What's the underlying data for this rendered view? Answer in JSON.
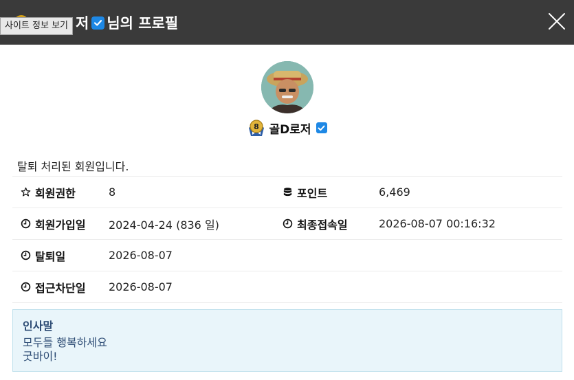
{
  "header": {
    "title_fragment": "저",
    "title_suffix": "님의 프로필",
    "tooltip": "사이트 정보 보기"
  },
  "profile": {
    "level": "8",
    "nickname": "골D로저"
  },
  "notice": "탈퇴 처리된 회원입니다.",
  "info": {
    "level_label": "회원권한",
    "level_value": "8",
    "points_label": "포인트",
    "points_value": "6,469",
    "joined_label": "회원가입일",
    "joined_value": "2024-04-24 (836 일)",
    "last_login_label": "최종접속일",
    "last_login_value": "2026-08-07 00:16:32",
    "withdrawn_label": "탈퇴일",
    "withdrawn_value": "2026-08-07",
    "blocked_label": "접근차단일",
    "blocked_value": "2026-08-07"
  },
  "greeting": {
    "title": "인사말",
    "lines": [
      "모두들 행복하세요",
      "굿바이!"
    ]
  },
  "colors": {
    "header_bg": "#3a3a3a",
    "accent_blue": "#1e88e5",
    "greeting_bg": "#e9f5fa",
    "greeting_text": "#2b4a73"
  },
  "icons": {
    "close": "close-icon",
    "star": "star-outline-icon",
    "database": "database-icon",
    "clock": "clock-icon",
    "check": "checkbox-check-icon"
  }
}
